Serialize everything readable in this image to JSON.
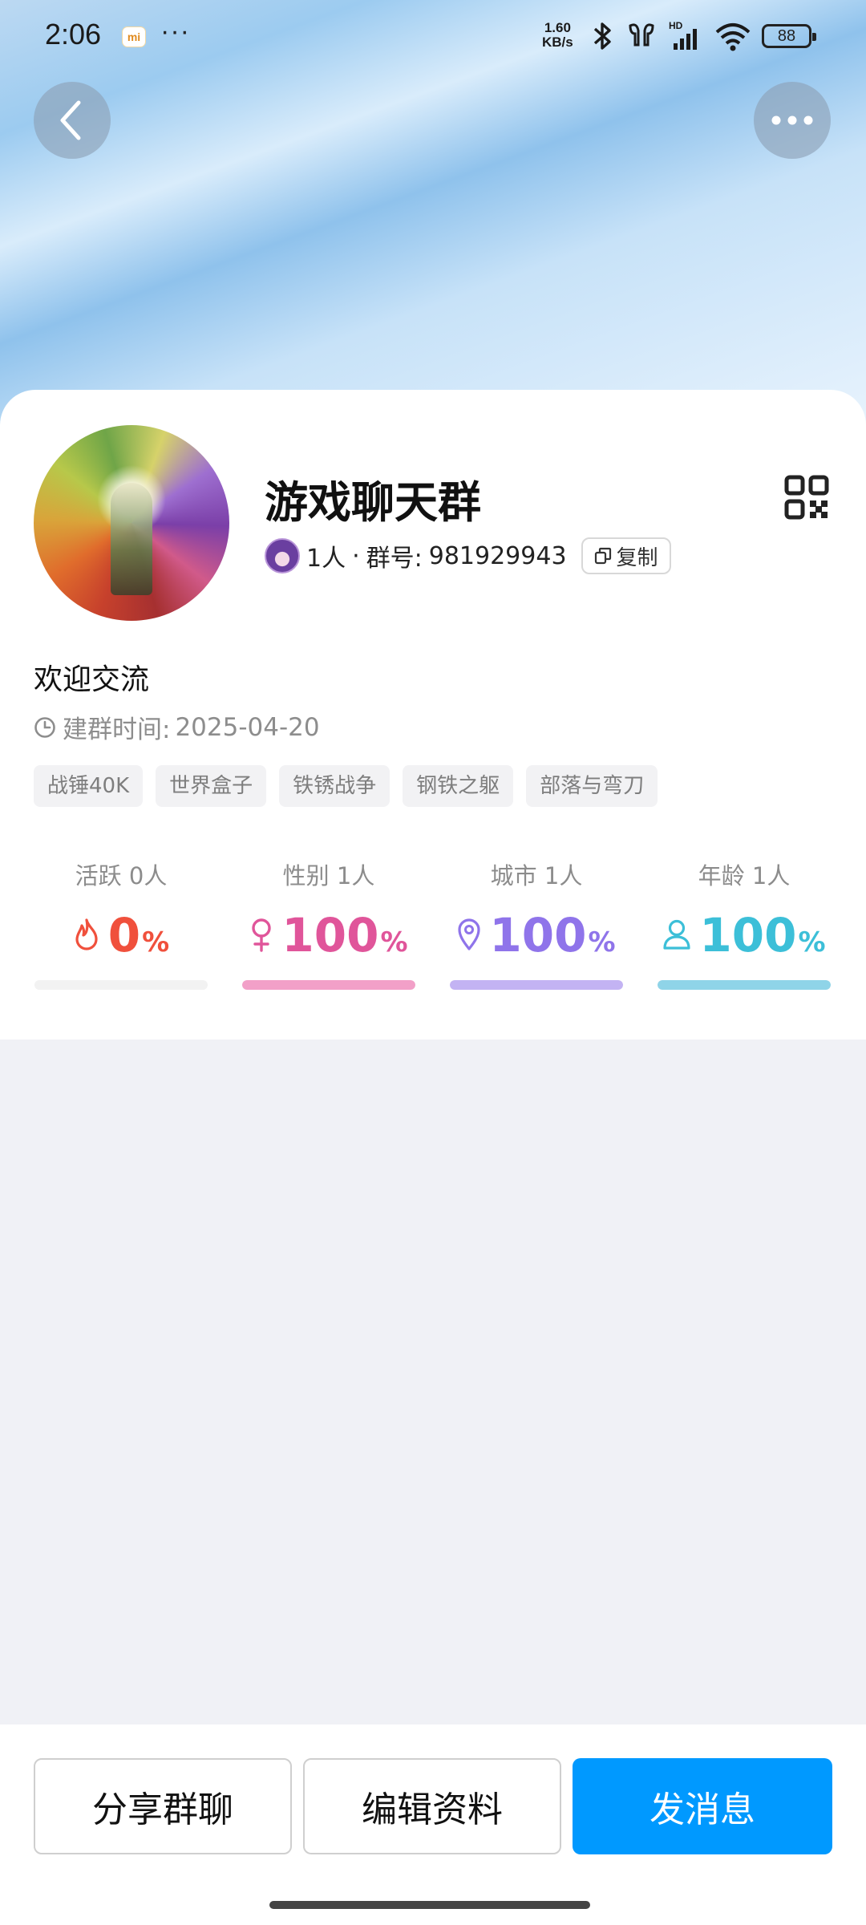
{
  "status_bar": {
    "time": "2:06",
    "app_badge": "mi",
    "more_dots": "···",
    "net_speed_value": "1.60",
    "net_speed_unit": "KB/s",
    "battery": "88"
  },
  "header": {
    "back_icon": "chevron-left-icon",
    "more_icon": "more-horizontal-icon"
  },
  "group": {
    "name": "游戏聊天群",
    "members": "1人",
    "separator": "·",
    "id_label": "群号:",
    "id_value": "981929943",
    "copy_label": "复制",
    "description": "欢迎交流",
    "created_label": "建群时间:",
    "created_date": "2025-04-20",
    "tags": [
      "战锤40K",
      "世界盒子",
      "铁锈战争",
      "钢铁之躯",
      "部落与弯刀"
    ]
  },
  "stats": [
    {
      "label": "活跃 0人",
      "value": "0",
      "unit": "%",
      "icon": "flame-icon",
      "color": "#f0503c",
      "fill": 0.0
    },
    {
      "label": "性别 1人",
      "value": "100",
      "unit": "%",
      "icon": "female-icon",
      "color": "#e0559a",
      "fill": 1.0
    },
    {
      "label": "城市 1人",
      "value": "100",
      "unit": "%",
      "icon": "location-pin-icon",
      "color": "#8f74ea",
      "fill": 1.0
    },
    {
      "label": "年龄 1人",
      "value": "100",
      "unit": "%",
      "icon": "person-icon",
      "color": "#3cbfd8",
      "fill": 1.0
    }
  ],
  "stat_bar_colors": [
    "#f0503c",
    "#f2a0c8",
    "#c3b3f3",
    "#8fd4e8"
  ],
  "actions": {
    "share": "分享群聊",
    "edit": "编辑资料",
    "message": "发消息"
  },
  "colors": {
    "primary": "#0099ff",
    "page_bg": "#f0f1f6"
  }
}
